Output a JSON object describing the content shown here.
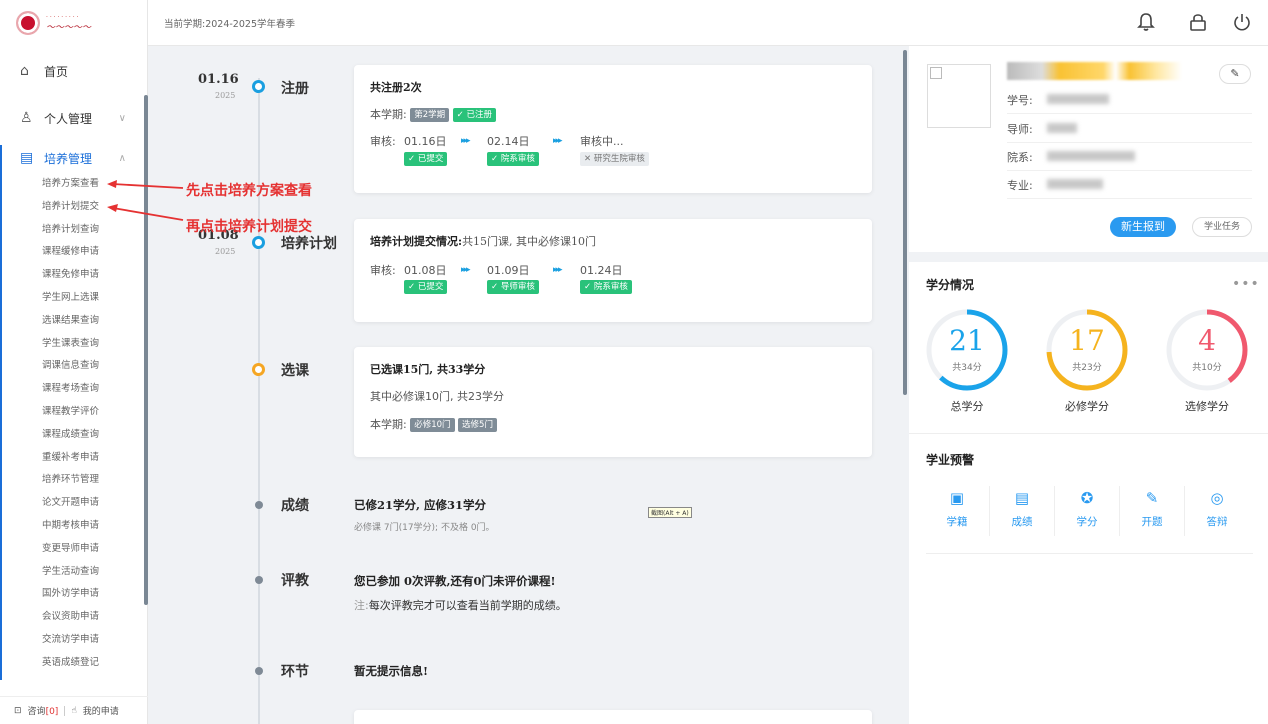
{
  "topbar": {
    "semester": "当前学期:2024-2025学年春季"
  },
  "sidebar": {
    "main_items": [
      {
        "label": "首页",
        "icon": "home-icon"
      },
      {
        "label": "个人管理",
        "icon": "user-icon"
      },
      {
        "label": "培养管理",
        "icon": "training-icon"
      }
    ],
    "sub_items": [
      "培养方案查看",
      "培养计划提交",
      "培养计划查询",
      "课程缓修申请",
      "课程免修申请",
      "学生网上选课",
      "选课结果查询",
      "学生课表查询",
      "调课信息查询",
      "课程考场查询",
      "课程教学评价",
      "课程成绩查询",
      "重缓补考申请",
      "培养环节管理",
      "论文开题申请",
      "中期考核申请",
      "变更导师申请",
      "学生活动查询",
      "国外访学申请",
      "会议资助申请",
      "交流访学申请",
      "英语成绩登记"
    ],
    "footer": {
      "consult": "咨询",
      "consult_count": "[0]",
      "my_apply": "我的申请"
    }
  },
  "annotations": {
    "first": "先点击培养方案查看",
    "second": "再点击培养计划提交"
  },
  "timeline": {
    "register": {
      "date": "01.16",
      "year": "2025",
      "label": "注册",
      "title": "共注册2次",
      "semester_label": "本学期:",
      "semester_tag": "第2学期",
      "status_tag": "✓ 已注册",
      "review_label": "审核:",
      "steps": [
        {
          "date": "01.16日",
          "tag": "✓ 已提交"
        },
        {
          "date": "02.14日",
          "tag": "✓ 院系审核"
        },
        {
          "date": "审核中...",
          "tag": "✕ 研究生院审核"
        }
      ]
    },
    "plan": {
      "date": "01.08",
      "year": "2025",
      "label": "培养计划",
      "title_bold": "培养计划提交情况:",
      "title_light": "共15门课, 其中必修课10门",
      "review_label": "审核:",
      "steps": [
        {
          "date": "01.08日",
          "tag": "✓ 已提交"
        },
        {
          "date": "01.09日",
          "tag": "✓ 导师审核"
        },
        {
          "date": "01.24日",
          "tag": "✓ 院系审核"
        }
      ]
    },
    "course": {
      "label": "选课",
      "title": "已选课15门, 共33学分",
      "sub": "其中必修课10门, 共23学分",
      "semester_label": "本学期:",
      "tag1": "必修10门",
      "tag2": "选修5门"
    },
    "score": {
      "label": "成绩",
      "title": "已修21学分, 应修31学分",
      "sub": "必修课 7门(17学分); 不及格 0门。",
      "tip": "截图(Alt + A)"
    },
    "eval": {
      "label": "评教",
      "title": "您已参加 0次评教,还有0门未评价课程!",
      "note_prefix": "注:",
      "note": "每次评教完才可以查看当前学期的成绩。"
    },
    "link": {
      "label": "环节",
      "title": "暂无提示信息!"
    }
  },
  "profile": {
    "fields": [
      {
        "label": "学号:"
      },
      {
        "label": "导师:"
      },
      {
        "label": "院系:"
      },
      {
        "label": "专业:"
      }
    ],
    "btn_new": "新生报到",
    "btn_task": "学业任务"
  },
  "credits": {
    "title": "学分情况",
    "items": [
      {
        "value": "21",
        "sub": "共34分",
        "caption": "总学分",
        "color": "#1aa3ea",
        "ratio": 0.62
      },
      {
        "value": "17",
        "sub": "共23分",
        "caption": "必修学分",
        "color": "#f5b31e",
        "ratio": 0.74
      },
      {
        "value": "4",
        "sub": "共10分",
        "caption": "选修学分",
        "color": "#f0596e",
        "ratio": 0.4
      }
    ]
  },
  "warning": {
    "title": "学业预警",
    "items": [
      {
        "label": "学籍",
        "icon": "id-card-icon"
      },
      {
        "label": "成绩",
        "icon": "report-icon"
      },
      {
        "label": "学分",
        "icon": "star-icon"
      },
      {
        "label": "开题",
        "icon": "edit-icon"
      },
      {
        "label": "答辩",
        "icon": "defense-icon"
      }
    ]
  },
  "colors": {
    "primary": "#2a9af0",
    "green": "#29c27a",
    "annotation": "#e53232"
  }
}
